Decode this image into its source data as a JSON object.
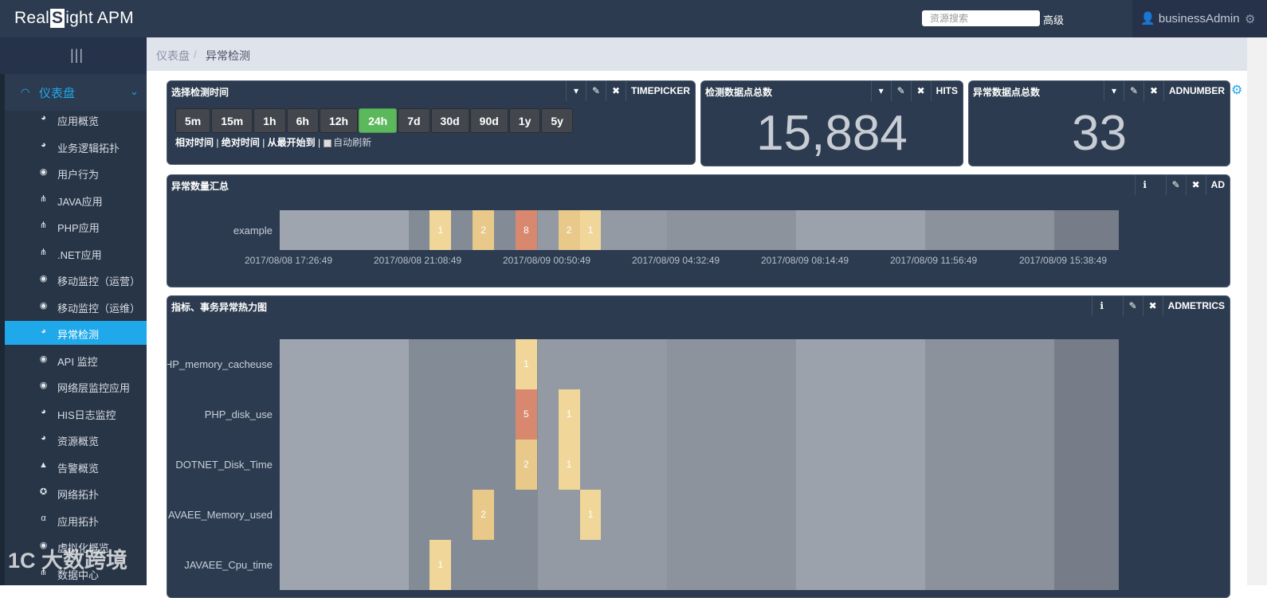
{
  "app": {
    "logo_prefix": "Real",
    "logo_mark": "S",
    "logo_suffix": "ight APM"
  },
  "topbar": {
    "search_placeholder": "资源搜索",
    "advanced_label": "高级",
    "user_name": "businessAdmin",
    "gear_glyph": "⚙"
  },
  "sidebar": {
    "toggle_glyph": "|||",
    "dashboard": {
      "label": "仪表盘",
      "icon": "gauge-icon"
    },
    "items": [
      {
        "label": "应用概览",
        "icon": "globe-icon",
        "active": false
      },
      {
        "label": "业务逻辑拓扑",
        "icon": "globe-icon",
        "active": false
      },
      {
        "label": "用户行为",
        "icon": "dashboard-icon",
        "active": false
      },
      {
        "label": "JAVA应用",
        "icon": "sitemap-icon",
        "active": false
      },
      {
        "label": "PHP应用",
        "icon": "sitemap-icon",
        "active": false
      },
      {
        "label": ".NET应用",
        "icon": "sitemap-icon",
        "active": false
      },
      {
        "label": "移动监控（运营）",
        "icon": "dashboard-icon",
        "active": false
      },
      {
        "label": "移动监控（运维）",
        "icon": "dashboard-icon",
        "active": false
      },
      {
        "label": "异常检测",
        "icon": "globe-icon",
        "active": true
      },
      {
        "label": "API 监控",
        "icon": "dashboard-icon",
        "active": false
      },
      {
        "label": "网络层监控应用",
        "icon": "dashboard-icon",
        "active": false
      },
      {
        "label": "HIS日志监控",
        "icon": "globe-icon",
        "active": false
      },
      {
        "label": "资源概览",
        "icon": "globe-icon",
        "active": false
      },
      {
        "label": "告警概览",
        "icon": "warning-icon",
        "active": false
      },
      {
        "label": "网络拓扑",
        "icon": "network-icon",
        "active": false
      },
      {
        "label": "应用拓扑",
        "icon": "alpha-icon",
        "active": false
      },
      {
        "label": "虚拟化概览",
        "icon": "dashboard-icon",
        "active": false
      },
      {
        "label": "数据中心",
        "icon": "sitemap-icon",
        "active": false
      }
    ]
  },
  "breadcrumb": {
    "root": "仪表盘",
    "separator": "/",
    "current": "异常检测"
  },
  "timepicker": {
    "title": "选择检测时间",
    "tag": "TIMEPICKER",
    "ranges": [
      "5m",
      "15m",
      "1h",
      "6h",
      "12h",
      "24h",
      "7d",
      "30d",
      "90d",
      "1y",
      "5y"
    ],
    "selected": "24h",
    "link_relative": "相对时间",
    "link_absolute": "绝对时间",
    "link_from_start": "从最开始到",
    "auto_refresh_label": "自动刷新",
    "divider": "|"
  },
  "hits_panel": {
    "title": "检测数据点总数",
    "tag": "HITS",
    "value": "15,884"
  },
  "adnumber_panel": {
    "title": "异常数据点总数",
    "tag": "ADNUMBER",
    "value": "33"
  },
  "ad_panel": {
    "title": "异常数量汇总",
    "tag": "AD",
    "row_label": "example",
    "x_ticks": [
      "2017/08/08 17:26:49",
      "2017/08/08 21:08:49",
      "2017/08/09 00:50:49",
      "2017/08/09 04:32:49",
      "2017/08/09 08:14:49",
      "2017/08/09 11:56:49",
      "2017/08/09 15:38:49"
    ]
  },
  "admetrics_panel": {
    "title": "指标、事务异常热力图",
    "tag": "ADMETRICS",
    "rows": [
      "HP_memory_cacheuse",
      "PHP_disk_use",
      "DOTNET_Disk_Time",
      "AVAEE_Memory_used",
      "JAVAEE_Cpu_time"
    ]
  },
  "tool_glyphs": {
    "caret": "▾",
    "wrench": "✎",
    "close": "✖",
    "info": "ℹ"
  },
  "watermark": "1C  大数跨境",
  "colors": {
    "accent": "#1fa9ea",
    "selected_range": "#5cb85c",
    "panel_bg": "#2c3b4f",
    "anomaly_low": "#f0d799",
    "anomaly_mid": "#e8c98a",
    "anomaly_high": "#d8886f"
  }
}
